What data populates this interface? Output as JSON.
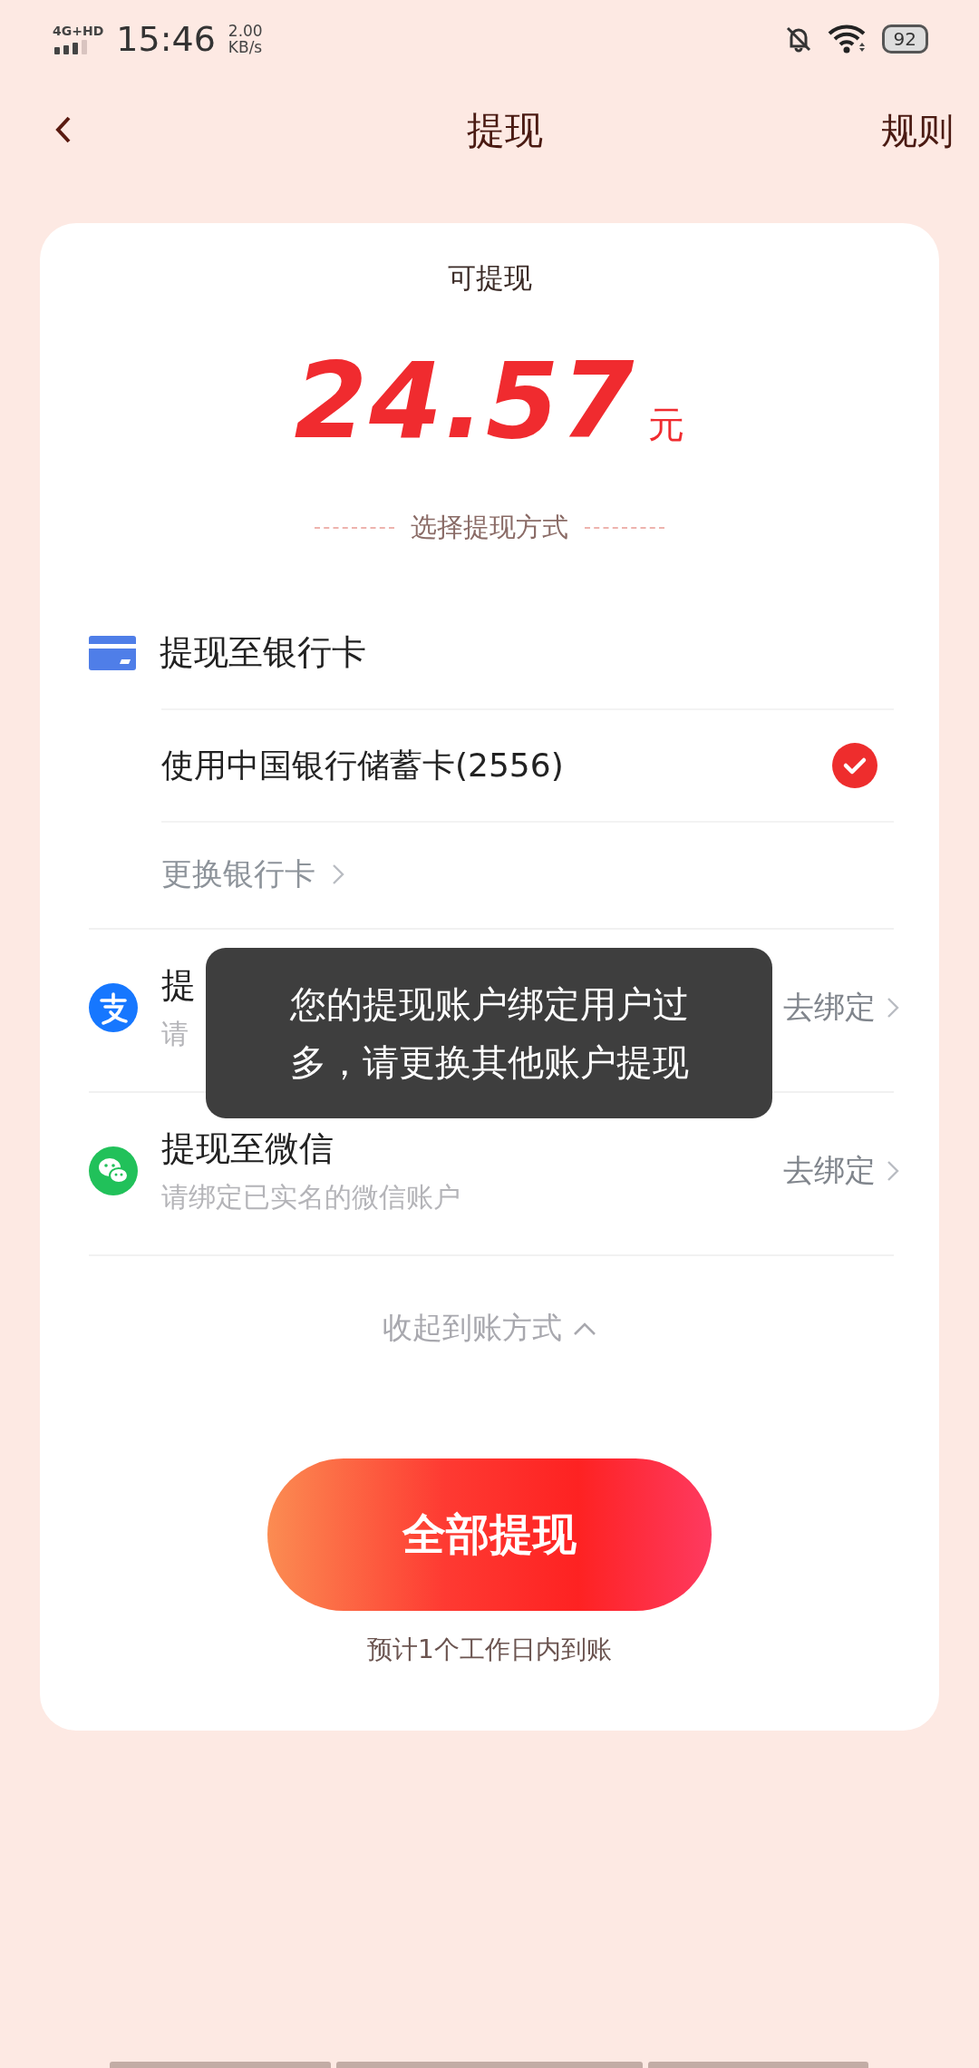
{
  "status_bar": {
    "network": "4G+HD",
    "time": "15:46",
    "speed": "2.00",
    "speed_unit": "KB/s",
    "battery": "92"
  },
  "header": {
    "title": "提现",
    "action": "规则"
  },
  "balance": {
    "label": "可提现",
    "amount": "24.57",
    "unit": "元"
  },
  "method_heading": "选择提现方式",
  "methods": [
    {
      "kind": "bank",
      "title": "提现至银行卡",
      "cards": [
        {
          "label": "使用中国银行储蓄卡(2556)",
          "selected": true
        }
      ],
      "change_link": "更换银行卡"
    },
    {
      "kind": "alipay",
      "title": "提",
      "subtitle": "请",
      "action": "去绑定"
    },
    {
      "kind": "wechat",
      "title": "提现至微信",
      "subtitle": "请绑定已实名的微信账户",
      "action": "去绑定"
    }
  ],
  "collapse_link": "收起到账方式",
  "submit_button": "全部提现",
  "note": "预计1个工作日内到账",
  "toast": "您的提现账户绑定用户过多，请更换其他账户提现"
}
